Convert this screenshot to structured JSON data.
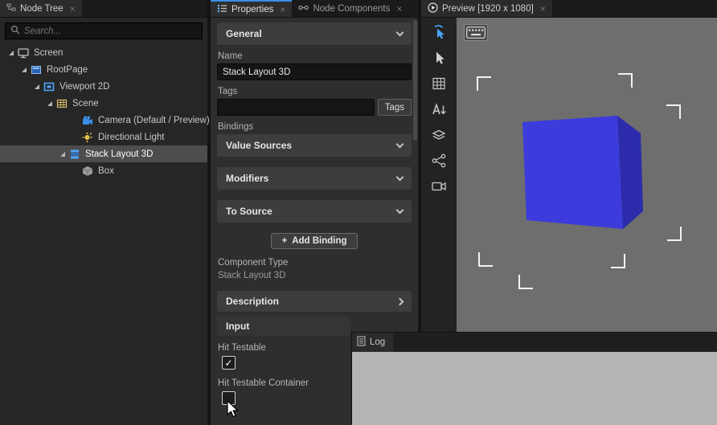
{
  "ui": {
    "close": "×",
    "plus": "+"
  },
  "node_tree": {
    "tab_label": "Node Tree",
    "search_placeholder": "Search...",
    "items": [
      {
        "label": "Screen",
        "icon": "screen-icon"
      },
      {
        "label": "RootPage",
        "icon": "page-icon"
      },
      {
        "label": "Viewport 2D",
        "icon": "viewport-icon"
      },
      {
        "label": "Scene",
        "icon": "scene-icon"
      },
      {
        "label": "Camera (Default / Preview)",
        "icon": "camera-icon"
      },
      {
        "label": "Directional Light",
        "icon": "light-icon"
      },
      {
        "label": "Stack Layout 3D",
        "icon": "stack-layout-icon",
        "selected": true
      },
      {
        "label": "Box",
        "icon": "box-icon"
      }
    ]
  },
  "tabs": {
    "properties": "Properties",
    "node_components": "Node Components",
    "preview": "Preview [1920 x 1080]",
    "log": "Log"
  },
  "properties": {
    "general_header": "General",
    "name_label": "Name",
    "name_value": "Stack Layout 3D",
    "tags_label": "Tags",
    "tags_value": "",
    "tags_button": "Tags",
    "bindings_label": "Bindings",
    "value_sources_header": "Value Sources",
    "modifiers_header": "Modifiers",
    "to_source_header": "To Source",
    "add_binding_button": "Add Binding",
    "component_type_label": "Component Type",
    "component_type_value": "Stack Layout 3D",
    "description_header": "Description",
    "input_header": "Input",
    "hit_testable_label": "Hit Testable",
    "hit_testable_check": "✓",
    "hit_testable_container_label": "Hit Testable Container",
    "hit_testable_container_check": ""
  },
  "colors": {
    "accent": "#3a8fe8",
    "selection_highlight": "#4d4d4d",
    "viewport_bg": "#6e6e6e",
    "cube_front": "#3c3cdc",
    "cube_side": "#2b2bab",
    "log_bg": "#b5b5b5"
  }
}
